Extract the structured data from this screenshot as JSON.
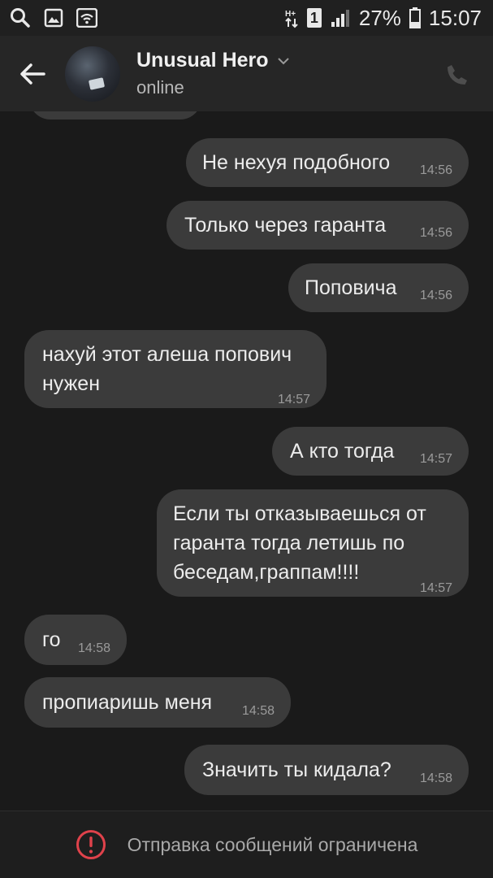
{
  "status_bar": {
    "battery": "27%",
    "time": "15:07",
    "sim_label": "1",
    "left_icons": [
      "search-icon",
      "image-icon",
      "wifi-icon"
    ],
    "right_icons": [
      "data-arrows-icon",
      "sim-icon",
      "signal-icon",
      "battery-icon"
    ]
  },
  "header": {
    "name": "Unusual Hero",
    "status": "online",
    "icons": [
      "back-arrow-icon",
      "chevron-down-icon",
      "phone-icon"
    ]
  },
  "messages": [
    {
      "text": "Не нехуя подобного",
      "time": "14:56",
      "side": "out"
    },
    {
      "text": "Только через гаранта",
      "time": "14:56",
      "side": "out"
    },
    {
      "text": "Поповича",
      "time": "14:56",
      "side": "out"
    },
    {
      "text": "нахуй этот алеша попович нужен",
      "time": "14:57",
      "side": "in"
    },
    {
      "text": "А кто тогда",
      "time": "14:57",
      "side": "out"
    },
    {
      "text": "Если ты отказываешься от гаранта тогда летишь по беседам,граппам!!!!",
      "time": "14:57",
      "side": "out"
    },
    {
      "text": "го",
      "time": "14:58",
      "side": "in"
    },
    {
      "text": "пропиаришь меня",
      "time": "14:58",
      "side": "in"
    },
    {
      "text": "Значить ты кидала?",
      "time": "14:58",
      "side": "out"
    }
  ],
  "footer": {
    "notice": "Отправка сообщений ограничена",
    "icon": "alert-circle-icon",
    "alert_color": "#e0424b"
  },
  "colors": {
    "background": "#1a1a1a",
    "header": "#262626",
    "bubble": "#3b3b3b"
  }
}
